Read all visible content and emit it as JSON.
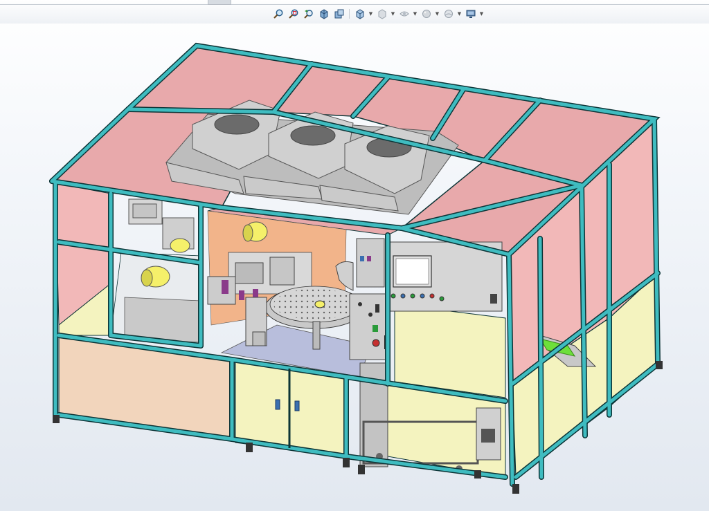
{
  "app": "CAD 3D viewport",
  "heads_up_toolbar": {
    "buttons": [
      {
        "name": "zoom-to-fit-icon",
        "dropdown": false
      },
      {
        "name": "zoom-to-area-icon",
        "dropdown": false
      },
      {
        "name": "previous-view-icon",
        "dropdown": false
      },
      {
        "name": "section-view-icon",
        "dropdown": false
      },
      {
        "name": "dynamic-annotation-icon",
        "dropdown": false
      },
      {
        "name": "view-orientation-icon",
        "dropdown": true
      },
      {
        "name": "display-style-icon",
        "dropdown": true
      },
      {
        "name": "hide-show-items-icon",
        "dropdown": true
      },
      {
        "name": "edit-appearance-icon",
        "dropdown": true
      },
      {
        "name": "apply-scene-icon",
        "dropdown": true
      },
      {
        "name": "view-settings-icon",
        "dropdown": true
      }
    ]
  },
  "colors": {
    "frame": "#3fbcc0",
    "frame_edge": "#0c3436",
    "panel_pink": "#f2b8b8",
    "panel_pink_top": "#e8a9ab",
    "panel_yellow": "#f4f3bf",
    "panel_peach": "#f2d5bc",
    "cover_gray": "#c8c8c8",
    "accent_green": "#6ddf3a",
    "table_blue": "#b8bedc"
  }
}
